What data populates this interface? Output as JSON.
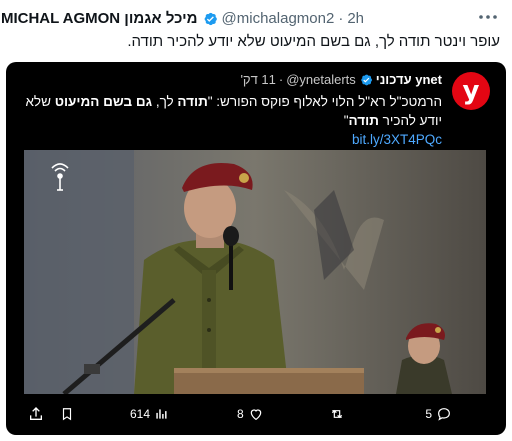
{
  "tweet": {
    "display_name": "MICHAL AGMON מיכל אגמון",
    "handle": "@michalagmon2",
    "time": "2h",
    "text": "עופר וינטר תודה לך, גם בשם המיעוט שלא יודע להכיר תודה."
  },
  "embed": {
    "author_name": "ynet עדכוני",
    "handle": "@ynetalerts",
    "time": "11 דק'",
    "text_prefix": "הרמטכ\"ל רא\"ל הלוי לאלוף פוקס הפורש: \"",
    "text_bold_1": "תודה",
    "text_mid": " לך, ",
    "text_bold_2": "גם בשם המיעוט",
    "text_mid_2": " שלא יודע להכיר ",
    "text_bold_3": "תודה",
    "text_suffix": "\"",
    "link": "bit.ly/3XT4PQc",
    "logo_letter": "y"
  },
  "actions": {
    "replies": "5",
    "reposts": "",
    "likes": "8",
    "views": "614"
  },
  "colors": {
    "brand_red": "#e30613",
    "verified_blue": "#1d9bf0",
    "link_blue": "#4ea9ff"
  }
}
